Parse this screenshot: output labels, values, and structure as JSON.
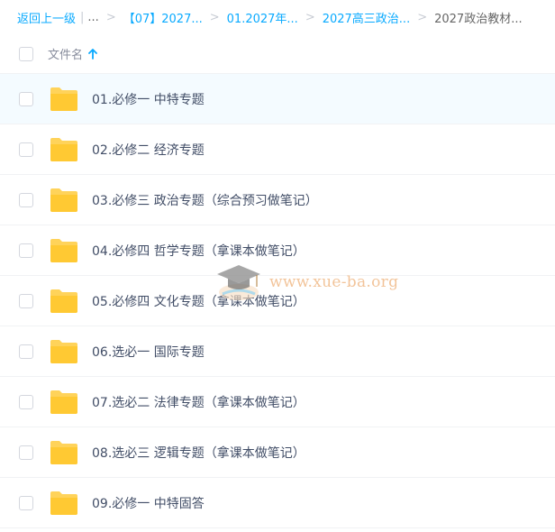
{
  "breadcrumb": {
    "back": "返回上一级",
    "ellipsis": "...",
    "items": [
      "【07】2027...",
      "01.2027年...",
      "2027高三政治..."
    ],
    "current": "2027政治教材..."
  },
  "header": {
    "column_name": "文件名"
  },
  "files": [
    {
      "name": "01.必修一 中特专题"
    },
    {
      "name": "02.必修二 经济专题"
    },
    {
      "name": "03.必修三 政治专题（综合预习做笔记）"
    },
    {
      "name": "04.必修四 哲学专题（拿课本做笔记）"
    },
    {
      "name": "05.必修四 文化专题（拿课本做笔记）"
    },
    {
      "name": "06.选必一 国际专题"
    },
    {
      "name": "07.选必二 法律专题（拿课本做笔记）"
    },
    {
      "name": "08.选必三 逻辑专题（拿课本做笔记）"
    },
    {
      "name": "09.必修一 中特固答"
    }
  ],
  "watermark": {
    "text": "www.xue-ba.org"
  },
  "colors": {
    "accent": "#09aaff",
    "folder": "#ffd35a",
    "hover_row": "#f4fbff"
  }
}
